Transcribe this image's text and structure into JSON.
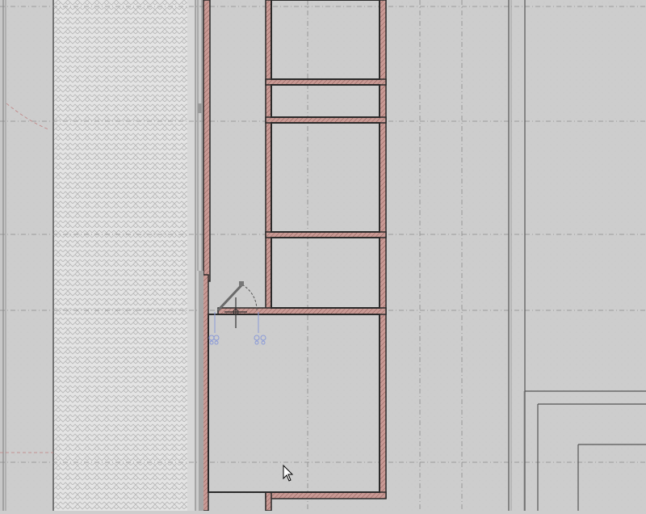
{
  "viewport": {
    "background": "#cdcdcd",
    "grid_color": "#8a8a8a",
    "wall_fill": "#b58b86",
    "wall_outline": "#2a2a2a",
    "hatch_background": "#e6e6e6",
    "hatch_stroke": "#b8b8b8",
    "selection_color": "#8a9ad8",
    "rebar_color": "#c08080"
  },
  "icons": {
    "door_symbol": "door-swing-icon",
    "crosshair": "crosshair-icon",
    "pointer": "mouse-pointer-icon",
    "grips": "grip-icon"
  }
}
